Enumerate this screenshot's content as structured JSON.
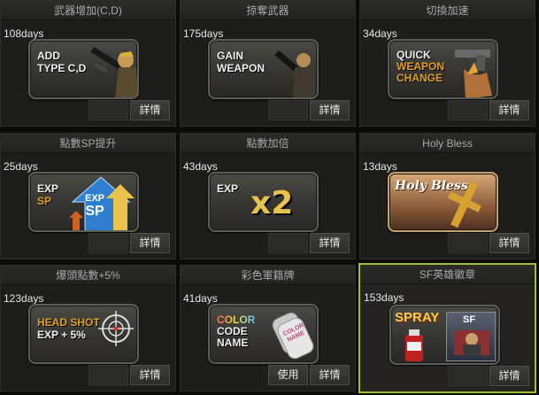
{
  "cards": [
    {
      "title": "武器增加(C,D)",
      "days": "108days",
      "badge_lines": [
        "ADD",
        "TYPE C,D"
      ],
      "buttons": [
        "詳情"
      ]
    },
    {
      "title": "掠奪武器",
      "days": "175days",
      "badge_lines": [
        "GAIN",
        "WEAPON"
      ],
      "buttons": [
        "詳情"
      ]
    },
    {
      "title": "切換加速",
      "days": "34days",
      "badge_lines": [
        "QUICK",
        "WEAPON",
        "CHANGE"
      ],
      "buttons": [
        "詳情"
      ]
    },
    {
      "title": "點數SP提升",
      "days": "25days",
      "badge_lines": [
        "EXP",
        "SP",
        "EXP",
        "SP"
      ],
      "buttons": [
        "詳情"
      ]
    },
    {
      "title": "點數加倍",
      "days": "43days",
      "badge_lines": [
        "EXP",
        "x2"
      ],
      "buttons": [
        "詳情"
      ]
    },
    {
      "title": "Holy Bless",
      "days": "13days",
      "badge_lines": [
        "Holy Bless"
      ],
      "buttons": [
        "詳情"
      ]
    },
    {
      "title": "爆頭點數+5%",
      "days": "123days",
      "badge_lines": [
        "HEAD SHOT",
        "EXP + 5%"
      ],
      "buttons": [
        "詳情"
      ]
    },
    {
      "title": "彩色軍籍牌",
      "days": "41days",
      "badge_lines": [
        "COLOR",
        "CODE",
        "NAME",
        "COLOR NAME"
      ],
      "buttons": [
        "使用",
        "詳情"
      ]
    },
    {
      "title": "SF英雄徽章",
      "days": "153days",
      "badge_lines": [
        "SPRAY",
        "SF"
      ],
      "buttons": [
        "詳情"
      ],
      "selected": true
    }
  ],
  "colors": {
    "selected_border": "#9fbf3a",
    "badge_orange": "#e0a020",
    "blue_arrow": "#2e7fd0",
    "yellow_x2": "#e8c24a"
  },
  "icons": [
    "rifle-icon",
    "arrow-up-icon",
    "crosshair-icon",
    "dog-tag-icon",
    "spray-can-icon",
    "cross-icon"
  ]
}
